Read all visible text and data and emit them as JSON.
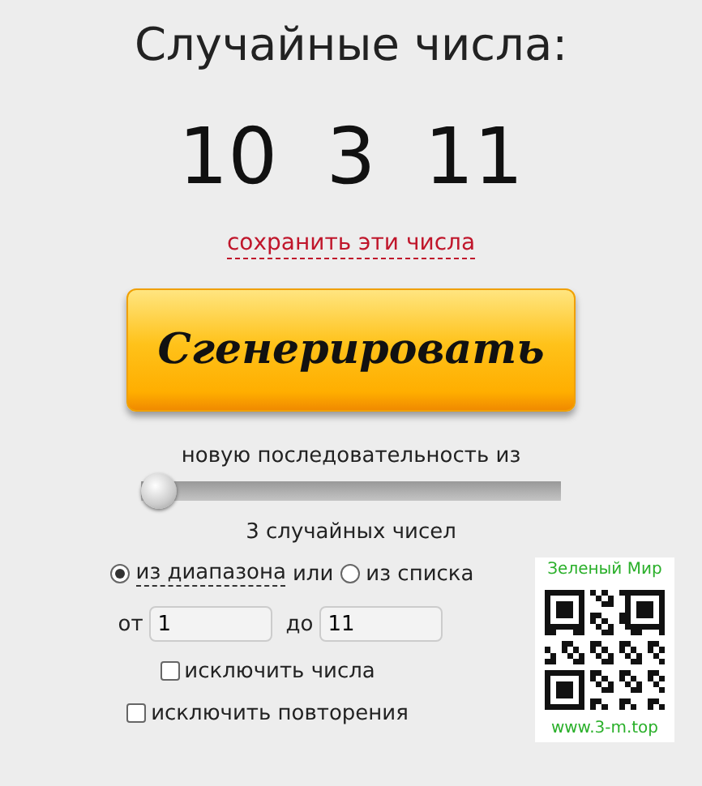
{
  "title": "Случайные числа:",
  "numbers": [
    "10",
    "3",
    "11"
  ],
  "save_link": "сохранить эти числа",
  "generate_button": "Сгенерировать",
  "sequence_label": "новую последовательность из",
  "count_slider": {
    "level": 0
  },
  "count_label": "3 случайных чисел",
  "source_options": [
    {
      "label": "из диапазона",
      "selected": true,
      "kind": "link"
    },
    {
      "label": "или",
      "kind": "text"
    },
    {
      "label": "из списка",
      "selected": false,
      "kind": "plain"
    }
  ],
  "range": {
    "from_label": "от",
    "from_value": "1",
    "to_label": "до",
    "to_value": "11"
  },
  "options": [
    {
      "label": "исключить числа",
      "checked": false
    },
    {
      "label": "исключить повторения",
      "checked": false
    }
  ],
  "qr_card": {
    "caption": "Зеленый Мир",
    "url": "www.3-m.top"
  }
}
